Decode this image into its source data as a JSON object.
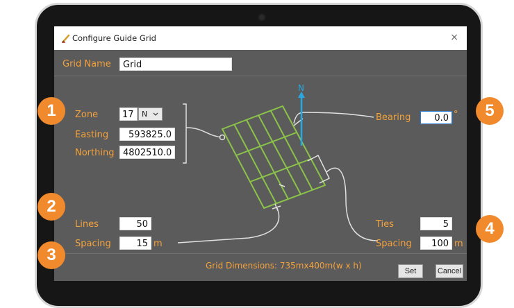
{
  "window": {
    "title": "Configure Guide Grid",
    "close_glyph": "×"
  },
  "grid_name": {
    "label": "Grid Name",
    "value": "Grid"
  },
  "position": {
    "zone_label": "Zone",
    "zone_value": "17",
    "hemisphere": "N",
    "easting_label": "Easting",
    "easting_value": "593825.0",
    "northing_label": "Northing",
    "northing_value": "4802510.0"
  },
  "bearing": {
    "label": "Bearing",
    "value": "0.0",
    "unit": "°"
  },
  "north_label": "N",
  "lines": {
    "label": "Lines",
    "value": "50",
    "spacing_label": "Spacing",
    "spacing_value": "15",
    "unit": "m"
  },
  "ties": {
    "label": "Ties",
    "value": "5",
    "spacing_label": "Spacing",
    "spacing_value": "100",
    "unit": "m"
  },
  "dimensions_text": "Grid Dimensions: 735mx400m(w x h)",
  "buttons": {
    "set": "Set",
    "cancel": "Cancel"
  },
  "badges": [
    "1",
    "2",
    "3",
    "4",
    "5"
  ],
  "colors": {
    "accent": "#f4a23c",
    "grid": "#8bc34a",
    "north": "#29a8e0",
    "badge": "#f08a2c"
  },
  "icons": {
    "app": "compass-pencil-icon",
    "close": "close-icon"
  }
}
